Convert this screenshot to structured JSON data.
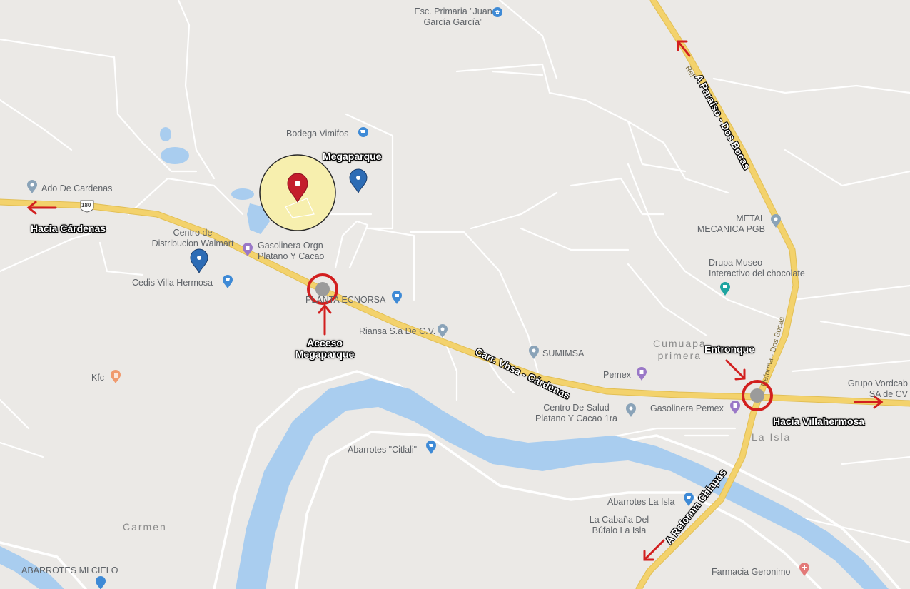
{
  "colors": {
    "land": "#ebe9e6",
    "river": "#a9cdef",
    "road_major": "#f3d26c",
    "road_minor": "#ffffff",
    "annotation_red": "#d21f1f",
    "highlight_circle": "#f7efae",
    "poi_blue": "#3e8ad6",
    "poi_pink": "#e37a79"
  },
  "pois": {
    "esc_primaria": "Esc. Primaria \"Juan\nGarcía García\"",
    "bodega": "Bodega Vimifos",
    "ado": "Ado De Cardenas",
    "centro_walmart": "Centro de\nDistribucion Walmart",
    "gasolinera_orgn": "Gasolinera Orgn\nPlatano Y Cacao",
    "cedis": "Cedis Villa Hermosa",
    "planta": "PLANTA ECNORSA",
    "riansa": "Riansa S.a De C.V.",
    "kfc": "Kfc",
    "sumimsa": "SUMIMSA",
    "metal": "METAL\nMECANICA PGB",
    "drupa": "Drupa Museo\nInteractivo del chocolate",
    "pemex": "Pemex",
    "centro_salud": "Centro De Salud\nPlatano Y Cacao 1ra",
    "gasolinera_pemex": "Gasolinera Pemex",
    "grupo": "Grupo Vordcab\nSA de CV",
    "abarrotes_citlali": "Abarrotes \"Citlali\"",
    "abarrotes_la_isla": "Abarrotes La Isla",
    "cabana": "La Cabaña Del\nBúfalo La Isla",
    "farmacia": "Farmacia Geronimo",
    "abarrotes_mi_cielo": "ABARROTES MI CIELO"
  },
  "places": {
    "carmen": "Carmen",
    "la_isla": "La Isla",
    "cumuapa": "Cumuapa\nprimera"
  },
  "annotations": {
    "megaparque": "Megaparque",
    "acceso": "Acceso\nMegaparque",
    "hacia_cardenas": "Hacia Cárdenas",
    "entronque": "Entronque",
    "hacia_villahermosa": "Hacia Villahermosa"
  },
  "roads": {
    "paraiso": "A Paraíso - Dos Bocas",
    "reforma_chiapas": "A Reforma Chiapas",
    "carr_vhsa": "Carr. Vhsa - Cárdenas",
    "reforma_dos_bocas_small": "Reforma - Dos Bocas",
    "ref_small": "Ref",
    "shield": "180"
  },
  "icons": [
    "shopping-cart-icon",
    "school-icon",
    "gas-station-icon",
    "location-pin-icon",
    "restaurant-icon",
    "museum-icon",
    "pharmacy-icon",
    "map-marker-icon",
    "red-arrow-icon"
  ]
}
